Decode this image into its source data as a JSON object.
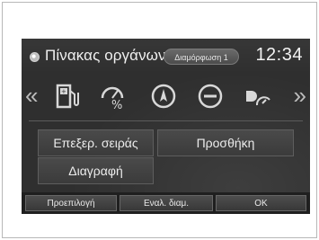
{
  "header": {
    "title": "Πίνακας οργάνων",
    "layout_label": "Διαμόρφωση 1",
    "clock": "12:34"
  },
  "icon_row": {
    "items": [
      {
        "name": "fuel-economy-icon"
      },
      {
        "name": "speed-mute-icon"
      },
      {
        "name": "navigation-compass-icon"
      },
      {
        "name": "minus-circle-icon"
      },
      {
        "name": "headlight-meter-icon"
      }
    ]
  },
  "menu": {
    "edit_order": "Επεξερ. σειράς",
    "add": "Προσθήκη",
    "delete": "Διαγραφή"
  },
  "softkeys": {
    "default": "Προεπιλογή",
    "switch_layout": "Εναλ. διαμ.",
    "ok": "OK"
  },
  "colors": {
    "screen_bg": "#2f2f2f",
    "text": "#f0f0f0"
  }
}
